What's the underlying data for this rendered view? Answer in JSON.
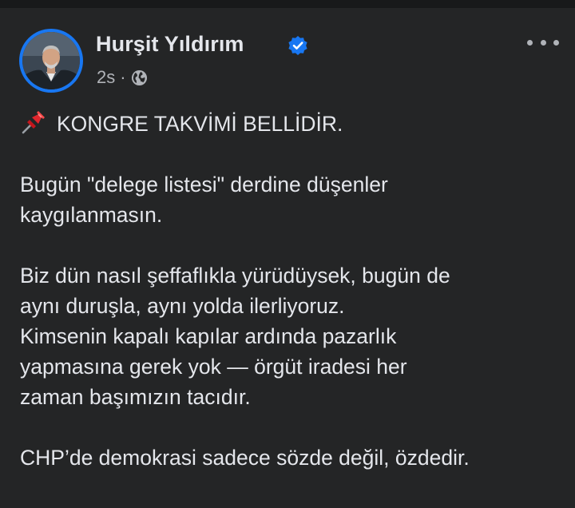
{
  "post": {
    "author": "Hurşit Yıldırım",
    "timestamp": "2s",
    "separator": "·",
    "visibility_icon": "globe-icon",
    "verified_icon": "verified-badge-icon",
    "more_icon": "more-options-icon",
    "lines": {
      "title": "KONGRE TAKVİMİ BELLİDİR.",
      "l1": "Bugün \"delege listesi\" derdine düşenler",
      "l2": "kaygılanmasın.",
      "l3": "Biz dün nasıl şeffaflıkla yürüdüysek, bugün de",
      "l4": "aynı duruşla, aynı yolda ilerliyoruz.",
      "l5": "Kimsenin kapalı kapılar ardında pazarlık",
      "l6": "yapmasına gerek yok — örgüt iradesi her",
      "l7": "zaman başımızın tacıdır.",
      "l8": "CHP’de demokrasi sadece sözde değil, özdedir."
    }
  },
  "colors": {
    "background": "#242526",
    "text_primary": "#e4e6eb",
    "text_secondary": "#b0b3b8",
    "accent": "#1877f2"
  }
}
